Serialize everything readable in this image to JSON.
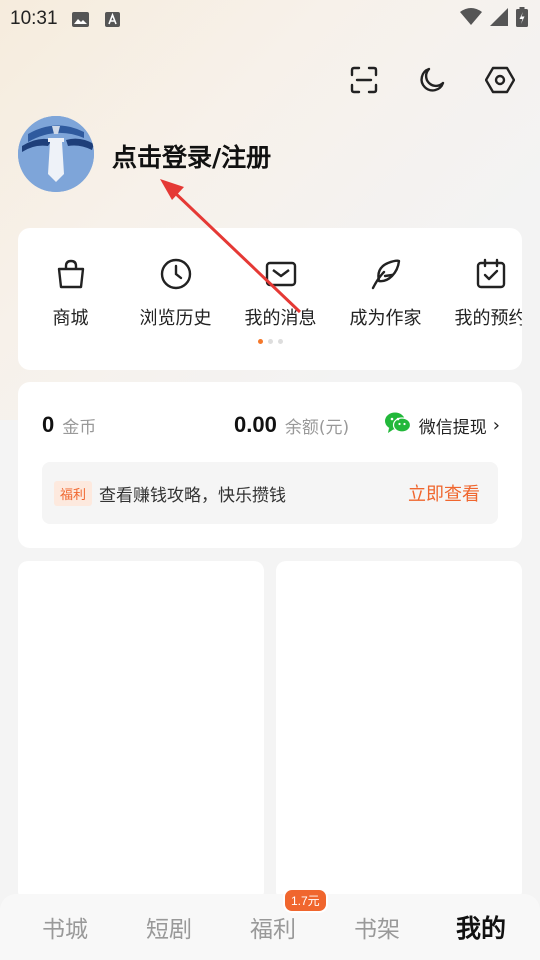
{
  "status_bar": {
    "time": "10:31"
  },
  "profile": {
    "login_text": "点击登录/注册"
  },
  "features": [
    {
      "label": "商城",
      "icon": "shopping-bag-icon"
    },
    {
      "label": "浏览历史",
      "icon": "clock-icon"
    },
    {
      "label": "我的消息",
      "icon": "envelope-icon"
    },
    {
      "label": "成为作家",
      "icon": "quill-icon"
    },
    {
      "label": "我的预约",
      "icon": "calendar-check-icon"
    }
  ],
  "wallet": {
    "coins": "0",
    "coins_unit": "金币",
    "balance": "0.00",
    "balance_unit": "余额(元)",
    "withdraw_label": "微信提现"
  },
  "promo": {
    "badge": "福利",
    "text": "查看赚钱攻略，快乐攒钱",
    "action": "立即查看"
  },
  "bottom_nav": {
    "items": [
      "书城",
      "短剧",
      "福利",
      "书架",
      "我的"
    ],
    "active": "我的",
    "badge": "1.7元"
  },
  "colors": {
    "accent": "#f0662e",
    "arrow": "#e53935",
    "wechat": "#22b83a"
  }
}
